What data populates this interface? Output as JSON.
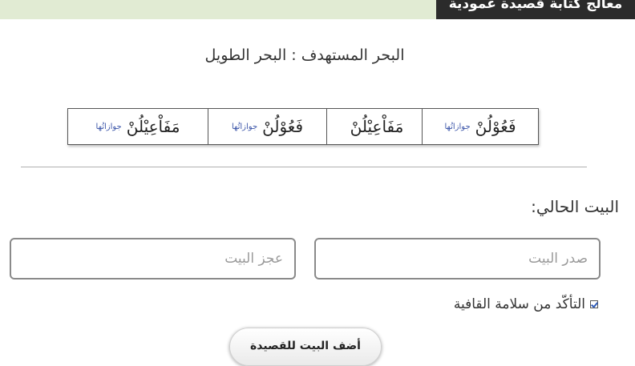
{
  "header": {
    "title": "معالج كتابة قصيدة عمودية"
  },
  "meter": {
    "text": "البحر المستهدف : البحر الطويل"
  },
  "feet": [
    {
      "name": "فَعُوْلُنْ",
      "link": "جوازاتُها"
    },
    {
      "name": "مَفَاْعِيْلُنْ",
      "link": ""
    },
    {
      "name": "فَعُوْلُنْ",
      "link": "جوازاتُها"
    },
    {
      "name": "مَفَاْعِيْلُنْ",
      "link": "جوازاتُها"
    }
  ],
  "verse": {
    "label": "البيت الحالي:",
    "sadr_placeholder": "صدر البيت",
    "ajz_placeholder": "عجز البيت"
  },
  "rhyme_check": {
    "label": "التأكّد من سلامة القافية",
    "checked": true
  },
  "add_button": {
    "label": "أضف البيت للقصيدة"
  },
  "colors": {
    "topbar": "#e1ebd3",
    "tab": "#2b2b2b",
    "link": "#3a54a8"
  }
}
